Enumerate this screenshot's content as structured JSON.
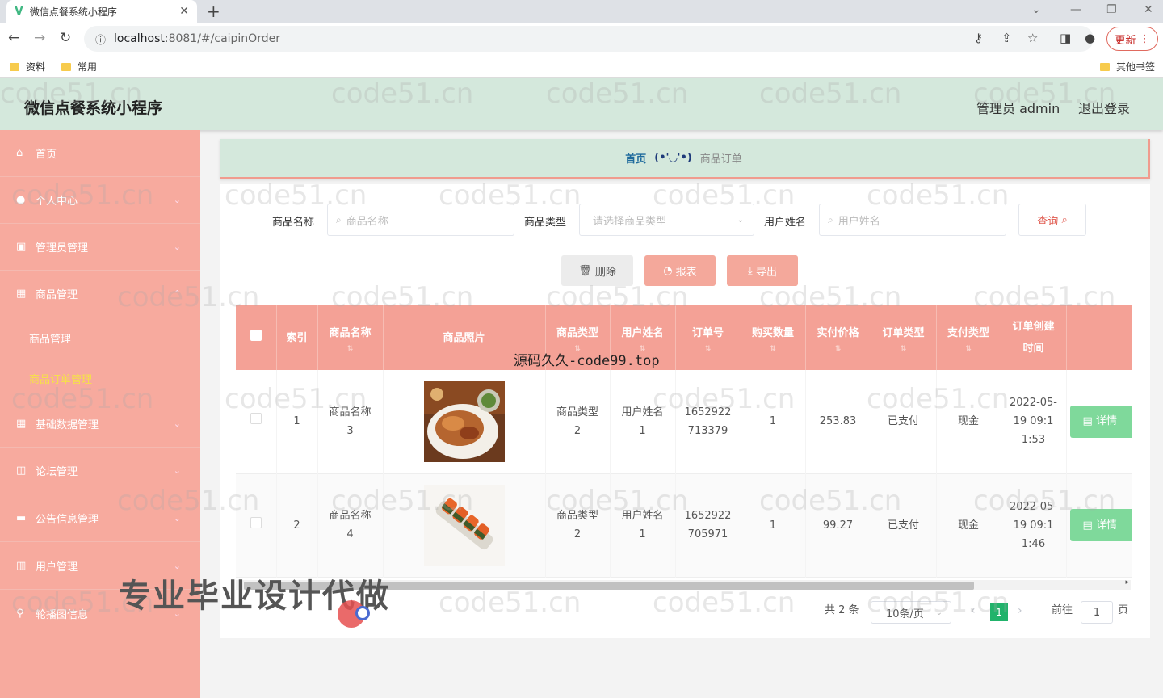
{
  "browser": {
    "tab_title": "微信点餐系统小程序",
    "url_host": "localhost",
    "url_path": ":8081/#/caipinOrder",
    "update_label": "更新",
    "bookmarks": [
      "资料",
      "常用"
    ],
    "other_bookmarks": "其他书签"
  },
  "header": {
    "title": "微信点餐系统小程序",
    "user": "管理员 admin",
    "logout": "退出登录"
  },
  "sidebar": {
    "items": [
      {
        "label": "首页",
        "icon": "home-icon"
      },
      {
        "label": "个人中心",
        "icon": "user-icon"
      },
      {
        "label": "管理员管理",
        "icon": "admin-icon"
      },
      {
        "label": "商品管理",
        "icon": "grid-icon"
      },
      {
        "label": "基础数据管理",
        "icon": "grid-icon"
      },
      {
        "label": "论坛管理",
        "icon": "forum-icon"
      },
      {
        "label": "公告信息管理",
        "icon": "message-icon"
      },
      {
        "label": "用户管理",
        "icon": "users-icon"
      },
      {
        "label": "轮播图信息",
        "icon": "pin-icon"
      }
    ],
    "sub_items": [
      {
        "label": "商品管理",
        "active": false
      },
      {
        "label": "商品订单管理",
        "active": true
      }
    ]
  },
  "breadcrumb": {
    "home": "首页",
    "separator": "(•'◡'•)",
    "current": "商品订单"
  },
  "search": {
    "name_label": "商品名称",
    "name_placeholder": "商品名称",
    "type_label": "商品类型",
    "type_placeholder": "请选择商品类型",
    "user_label": "用户姓名",
    "user_placeholder": "用户姓名",
    "query_label": "查询"
  },
  "actions": {
    "delete": "删除",
    "report": "报表",
    "export": "导出"
  },
  "table": {
    "headers": [
      "索引",
      "商品名称",
      "商品照片",
      "商品类型",
      "用户姓名",
      "订单号",
      "购买数量",
      "实付价格",
      "订单类型",
      "支付类型",
      "订单创建时间"
    ],
    "rows": [
      {
        "index": "1",
        "name": "商品名称3",
        "image": "food-plate-image",
        "type": "商品类型2",
        "user": "用户姓名1",
        "order_no": "1652922713379",
        "quantity": "1",
        "price": "253.83",
        "order_type": "已支付",
        "pay_type": "现金",
        "created": "2022-05-19 09:11:53",
        "detail": "详情"
      },
      {
        "index": "2",
        "name": "商品名称4",
        "image": "sushi-roll-image",
        "type": "商品类型2",
        "user": "用户姓名1",
        "order_no": "1652922705971",
        "quantity": "1",
        "price": "99.27",
        "order_type": "已支付",
        "pay_type": "现金",
        "created": "2022-05-19 09:11:46",
        "detail": "详情"
      }
    ]
  },
  "pagination": {
    "total": "共 2 条",
    "page_size": "10条/页",
    "current_page": "1",
    "goto_label": "前往",
    "goto_value": "1",
    "page_unit": "页"
  },
  "overlays": {
    "watermark": "code51.cn",
    "source_text": "源码久久-code99.top",
    "promo_text": "专业毕业设计代做"
  },
  "colors": {
    "sidebar": "#f7aa9e",
    "header": "#d4e8dc",
    "table_header": "#f4a196",
    "accent_green": "#21b36b"
  }
}
